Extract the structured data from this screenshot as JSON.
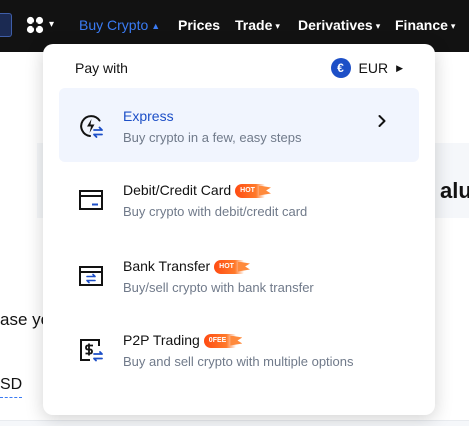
{
  "nav": {
    "items": [
      {
        "label": "Buy Crypto",
        "caret": "▲",
        "active": true
      },
      {
        "label": "Prices",
        "caret": "",
        "active": false
      },
      {
        "label": "Trade",
        "caret": "▾",
        "active": false
      },
      {
        "label": "Derivatives",
        "caret": "▾",
        "active": false
      },
      {
        "label": "Finance",
        "caret": "▾",
        "active": false
      }
    ],
    "apps_caret": "▾"
  },
  "dropdown": {
    "pay_with_label": "Pay with",
    "currency": {
      "symbol": "€",
      "code": "EUR",
      "caret": "▶"
    },
    "options": [
      {
        "title": "Express",
        "subtitle": "Buy crypto in a few, easy steps",
        "badge": "",
        "icon": "express-lightning-icon",
        "selected": true
      },
      {
        "title": "Debit/Credit Card",
        "subtitle": "Buy crypto with debit/credit card",
        "badge": "HOT",
        "icon": "credit-card-icon",
        "selected": false
      },
      {
        "title": "Bank Transfer",
        "subtitle": "Buy/sell crypto with bank transfer",
        "badge": "HOT",
        "icon": "bank-transfer-icon",
        "selected": false
      },
      {
        "title": "P2P Trading",
        "subtitle": "Buy and sell crypto with multiple options",
        "badge": "0FEE",
        "icon": "p2p-trading-icon",
        "selected": false
      }
    ]
  },
  "background": {
    "headline_fragment": "alue",
    "body_fragment": "ase yo",
    "currency_fragment": "SD"
  },
  "colors": {
    "nav_bg": "#121212",
    "accent": "#1d4fc7",
    "active_nav": "#3a7bf3",
    "selected_bg": "#f1f5fe",
    "badge": "#ff5a1f",
    "muted_text": "#707a8a"
  }
}
